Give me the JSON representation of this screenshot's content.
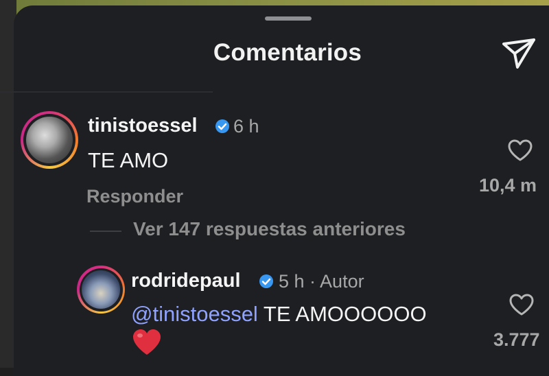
{
  "header": {
    "title": "Comentarios"
  },
  "comments": [
    {
      "username": "tinistoessel",
      "time": "6 h",
      "text": "TE AMO",
      "reply_label": "Responder",
      "like_count": "10,4 m"
    }
  ],
  "view_replies_label": "Ver 147 respuestas anteriores",
  "reply": {
    "username": "rodridepaul",
    "time_author": "5 h · Autor",
    "mention": "@tinistoessel",
    "text": " TE AMOOOOOO",
    "like_count": "3.777"
  },
  "colors": {
    "background": "#1d1f22",
    "verified": "#3897f0",
    "mention": "#8fa2ff",
    "heart_emoji": "#e0303f"
  },
  "icons": [
    "send-icon",
    "verified-icon",
    "heart-icon",
    "red-heart-emoji"
  ]
}
